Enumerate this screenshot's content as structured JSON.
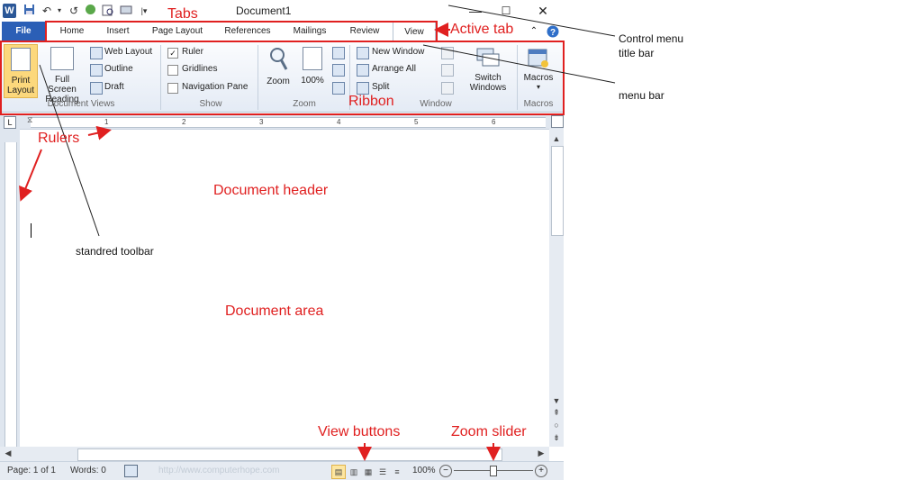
{
  "app": {
    "logo_letter": "W",
    "document_title": "Document1",
    "window_controls": {
      "minimize": "—",
      "maximize": "☐",
      "close": "✕"
    }
  },
  "quick_access": [
    "save-icon",
    "undo-icon",
    "redo-icon",
    "open-icon",
    "print-preview-icon",
    "customize-icon"
  ],
  "tabs": [
    {
      "label": "File"
    },
    {
      "label": "Home"
    },
    {
      "label": "Insert"
    },
    {
      "label": "Page Layout"
    },
    {
      "label": "References"
    },
    {
      "label": "Mailings"
    },
    {
      "label": "Review"
    },
    {
      "label": "View"
    }
  ],
  "ribbon": {
    "document_views": {
      "group_label": "Document Views",
      "print_layout": "Print Layout",
      "full_screen": "Full Screen Reading",
      "web_layout": "Web Layout",
      "outline": "Outline",
      "draft": "Draft"
    },
    "show": {
      "group_label": "Show",
      "ruler": "Ruler",
      "gridlines": "Gridlines",
      "navigation_pane": "Navigation Pane",
      "ruler_checked": true
    },
    "zoom": {
      "group_label": "Zoom",
      "zoom": "Zoom",
      "hundred": "100%"
    },
    "window": {
      "group_label": "Window",
      "new_window": "New Window",
      "arrange_all": "Arrange All",
      "split": "Split",
      "switch_windows": "Switch Windows"
    },
    "macros": {
      "group_label": "Macros",
      "macros": "Macros"
    }
  },
  "ruler": {
    "ticks": [
      "1",
      "2",
      "3",
      "4",
      "5",
      "6"
    ]
  },
  "statusbar": {
    "page": "Page: 1 of 1",
    "words": "Words: 0",
    "watermark": "http://www.computerhope.com",
    "zoom_level": "100%",
    "zoom_fraction": 0.5
  },
  "annotations": {
    "tabs": "Tabs",
    "active_tab": "Active tab",
    "control_menu": "Control menu\ntitle bar",
    "menu_bar": "menu bar",
    "ribbon": "Ribbon",
    "rulers": "Rulers",
    "document_header": "Document header",
    "standard_toolbar": "standred toolbar",
    "document_area": "Document area",
    "view_buttons": "View buttons",
    "zoom_slider": "Zoom slider"
  }
}
